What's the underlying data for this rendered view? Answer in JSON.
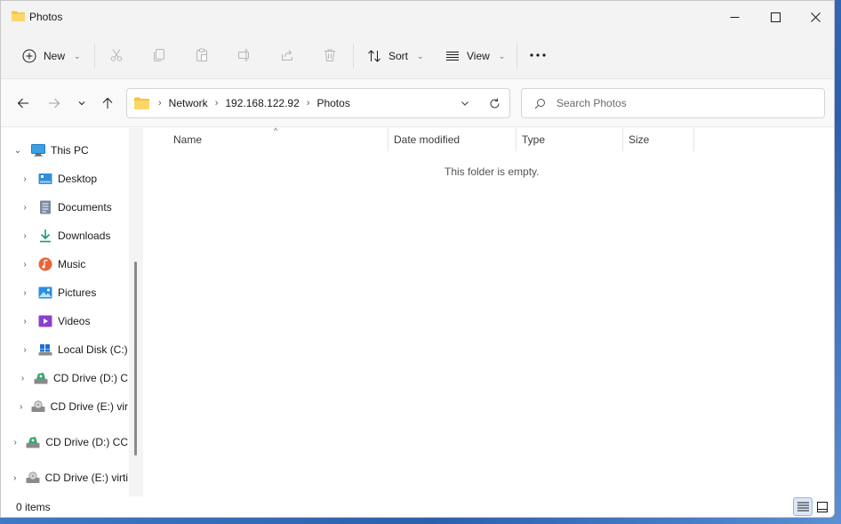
{
  "window": {
    "title": "Photos",
    "accent": "#0067c0",
    "folder_color": "#f5c342"
  },
  "window_controls": {
    "minimize": "minimize-icon",
    "maximize": "maximize-icon",
    "close": "close-icon"
  },
  "toolbar": {
    "new_label": "New",
    "sort_label": "Sort",
    "view_label": "View",
    "icons": [
      "cut-icon",
      "copy-icon",
      "paste-icon",
      "rename-icon",
      "share-icon",
      "delete-icon",
      "more-icon"
    ]
  },
  "address": {
    "crumbs": [
      "Network",
      "192.168.122.92",
      "Photos"
    ]
  },
  "search": {
    "placeholder": "Search Photos"
  },
  "nav": {
    "this_pc": "This PC",
    "items": [
      {
        "label": "Desktop",
        "icon": "desktop-icon"
      },
      {
        "label": "Documents",
        "icon": "documents-icon"
      },
      {
        "label": "Downloads",
        "icon": "downloads-icon"
      },
      {
        "label": "Music",
        "icon": "music-icon"
      },
      {
        "label": "Pictures",
        "icon": "pictures-icon"
      },
      {
        "label": "Videos",
        "icon": "videos-icon"
      },
      {
        "label": "Local Disk (C:)",
        "icon": "local-disk-icon"
      },
      {
        "label": "CD Drive (D:) C",
        "icon": "cd-drive-icon"
      },
      {
        "label": "CD Drive (E:) vir",
        "icon": "cd-drive-icon"
      }
    ],
    "root_items": [
      {
        "label": "CD Drive (D:) CC",
        "icon": "cd-drive-icon"
      },
      {
        "label": "CD Drive (E:) virti",
        "icon": "cd-drive-icon"
      }
    ]
  },
  "columns": {
    "name": "Name",
    "date_modified": "Date modified",
    "type": "Type",
    "size": "Size"
  },
  "content": {
    "empty_message": "This folder is empty."
  },
  "status": {
    "items": "0 items"
  }
}
